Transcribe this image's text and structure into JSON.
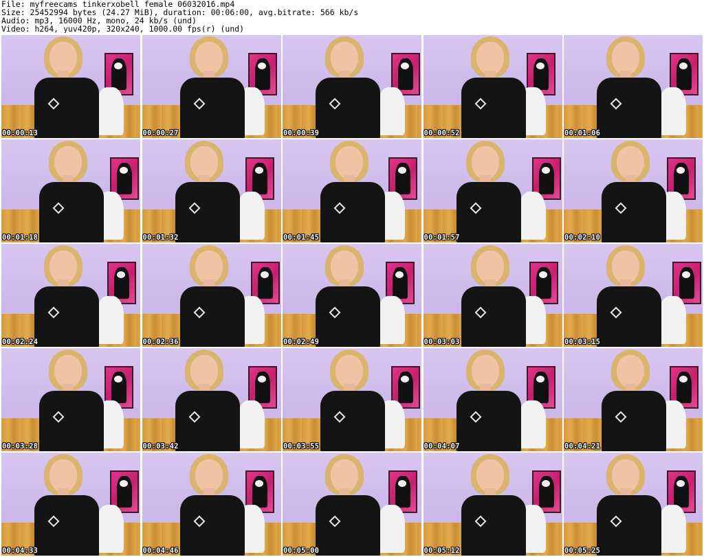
{
  "header": {
    "file_line": "File: myfreecams_tinkerxobell_female_06032016.mp4",
    "size_line": "Size: 25452994 bytes (24.27 MiB), duration: 00:06:00, avg.bitrate: 566 kb/s",
    "audio_line": "Audio: mp3, 16000 Hz, mono, 24 kb/s (und)",
    "video_line": "Video: h264, yuv420p, 320x240, 1000.00 fps(r) (und)"
  },
  "thumbnails": [
    {
      "timestamp": "00:00:13"
    },
    {
      "timestamp": "00:00:27"
    },
    {
      "timestamp": "00:00:39"
    },
    {
      "timestamp": "00:00:52"
    },
    {
      "timestamp": "00:01:06"
    },
    {
      "timestamp": "00:01:18"
    },
    {
      "timestamp": "00:01:32"
    },
    {
      "timestamp": "00:01:45"
    },
    {
      "timestamp": "00:01:57"
    },
    {
      "timestamp": "00:02:10"
    },
    {
      "timestamp": "00:02:24"
    },
    {
      "timestamp": "00:02:36"
    },
    {
      "timestamp": "00:02:49"
    },
    {
      "timestamp": "00:03:03"
    },
    {
      "timestamp": "00:03:15"
    },
    {
      "timestamp": "00:03:28"
    },
    {
      "timestamp": "00:03:42"
    },
    {
      "timestamp": "00:03:55"
    },
    {
      "timestamp": "00:04:07"
    },
    {
      "timestamp": "00:04:21"
    },
    {
      "timestamp": "00:04:33"
    },
    {
      "timestamp": "00:04:46"
    },
    {
      "timestamp": "00:05:00"
    },
    {
      "timestamp": "00:05:12"
    },
    {
      "timestamp": "00:05:25"
    }
  ]
}
